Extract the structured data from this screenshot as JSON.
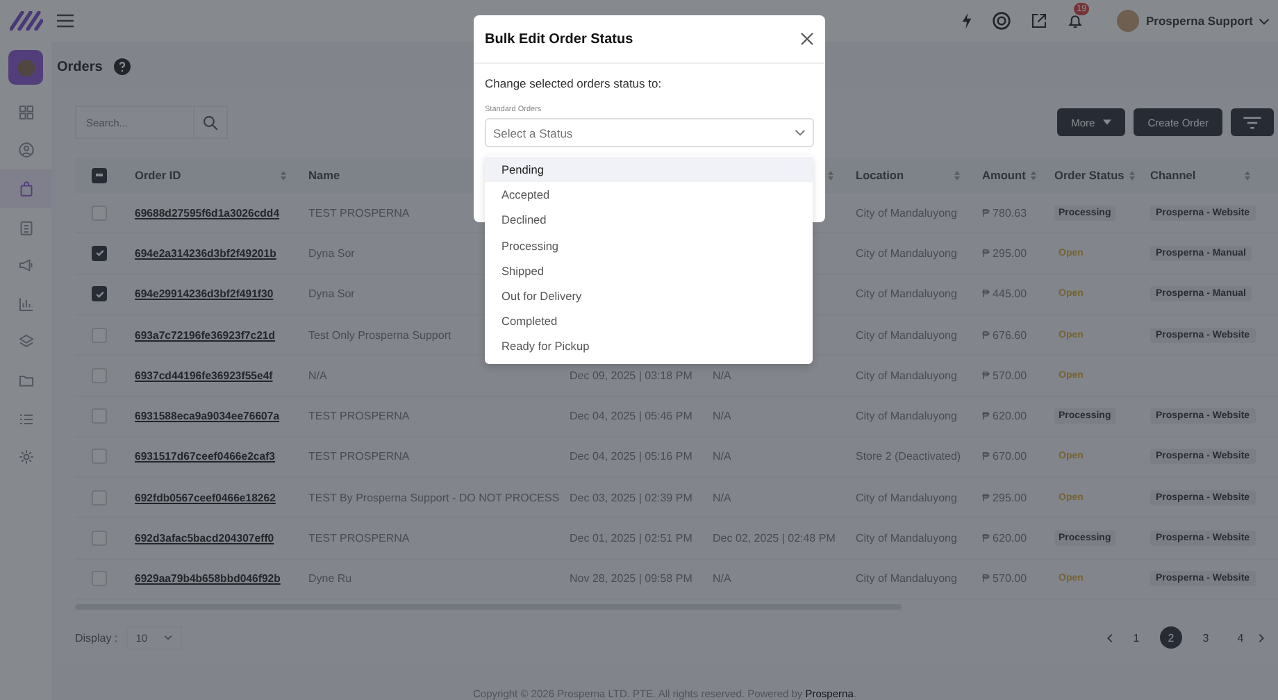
{
  "topbar": {
    "notifications": "19",
    "user": "Prosperna Support"
  },
  "sidebar": {
    "items": [
      {
        "kind": "dashboard",
        "selected": false
      },
      {
        "kind": "user",
        "selected": false
      },
      {
        "kind": "bag",
        "selected": true
      },
      {
        "kind": "clipboard",
        "selected": false
      },
      {
        "kind": "megaphone",
        "selected": false
      },
      {
        "kind": "chart",
        "selected": false
      },
      {
        "kind": "layers",
        "selected": false
      },
      {
        "kind": "folder",
        "selected": false
      },
      {
        "kind": "list",
        "selected": false
      },
      {
        "kind": "gear",
        "selected": false
      }
    ]
  },
  "page": {
    "title": "Orders"
  },
  "search": {
    "placeholder": "Search..."
  },
  "buttons": [
    {
      "kind": "menu",
      "label": "More"
    },
    {
      "kind": "plain",
      "label": "Create Order"
    },
    {
      "kind": "filter"
    }
  ],
  "table": {
    "header_checkbox": {
      "indeterminate": true
    },
    "columns": [
      {
        "label": "Order ID",
        "sortable": true
      },
      {
        "label": "Name",
        "sortable": false
      },
      {},
      {
        "sortable": true
      },
      {
        "label": "Location",
        "sortable": true
      },
      {
        "label": "Amount",
        "sortable": true
      },
      {
        "label": "Order Status",
        "sortable": true
      },
      {
        "label": "Channel",
        "sortable": true
      }
    ],
    "rows": [
      {
        "checked": false,
        "order_id": "69688d27595f6d1a3026cdd4",
        "name": "TEST PROSPERNA",
        "location": "City of Mandaluyong",
        "amount": "₱ 780.63",
        "status": "Processing",
        "status_badge": true,
        "channel": "Prosperna - Website"
      },
      {
        "checked": true,
        "order_id": "694e2a314236d3bf2f49201b",
        "name": "Dyna Sor",
        "location": "City of Mandaluyong",
        "amount": "₱ 295.00",
        "status": "Open",
        "status_badge": false,
        "channel": "Prosperna - Manual"
      },
      {
        "checked": true,
        "order_id": "694e29914236d3bf2f491f30",
        "name": "Dyna Sor",
        "location": "City of Mandaluyong",
        "amount": "₱ 445.00",
        "status": "Open",
        "status_badge": false,
        "channel": "Prosperna - Manual"
      },
      {
        "checked": false,
        "order_id": "693a7c72196fe36923f7c21d",
        "name": "Test Only Prosperna Support",
        "location": "City of Mandaluyong",
        "amount": "₱ 676.60",
        "status": "Open",
        "status_badge": false,
        "channel": "Prosperna - Website"
      },
      {
        "checked": false,
        "order_id": "6937cd44196fe36923f55e4f",
        "name": "N/A",
        "column_3": "Dec 09, 2025 | 03:18 PM",
        "column_4": "N/A",
        "location": "City of Mandaluyong",
        "amount": "₱ 570.00",
        "status": "Open",
        "status_badge": false
      },
      {
        "checked": false,
        "order_id": "6931588eca9a9034ee76607a",
        "name": "TEST PROSPERNA",
        "column_3": "Dec 04, 2025 | 05:46 PM",
        "column_4": "N/A",
        "location": "City of Mandaluyong",
        "amount": "₱ 620.00",
        "status": "Processing",
        "status_badge": true,
        "channel": "Prosperna - Website"
      },
      {
        "checked": false,
        "order_id": "6931517d67ceef0466e2caf3",
        "name": "TEST PROSPERNA",
        "column_3": "Dec 04, 2025 | 05:16 PM",
        "column_4": "N/A",
        "location": "Store 2 (Deactivated)",
        "amount": "₱ 670.00",
        "status": "Open",
        "status_badge": false,
        "channel": "Prosperna - Website"
      },
      {
        "checked": false,
        "order_id": "692fdb0567ceef0466e18262",
        "name": "TEST By Prosperna Support - DO NOT PROCESS",
        "column_3": "Dec 03, 2025 | 02:39 PM",
        "column_4": "N/A",
        "location": "City of Mandaluyong",
        "amount": "₱ 295.00",
        "status": "Open",
        "status_badge": false,
        "channel": "Prosperna - Website"
      },
      {
        "checked": false,
        "order_id": "692d3afac5bacd204307eff0",
        "name": "TEST PROSPERNA",
        "column_3": "Dec 01, 2025 | 02:51 PM",
        "column_4": "Dec 02, 2025 | 02:48 PM",
        "location": "City of Mandaluyong",
        "amount": "₱ 620.00",
        "status": "Processing",
        "status_badge": true,
        "channel": "Prosperna - Website"
      },
      {
        "checked": false,
        "order_id": "6929aa79b4b658bbd046f92b",
        "name": "Dyne Ru",
        "column_3": "Nov 28, 2025 | 09:58 PM",
        "column_4": "N/A",
        "location": "City of Mandaluyong",
        "amount": "₱ 570.00",
        "status": "Open",
        "status_badge": false,
        "channel": "Prosperna - Website"
      }
    ]
  },
  "display": {
    "label": "Display :",
    "value": "10"
  },
  "pagination": {
    "pages": [
      {
        "label": "1",
        "selected": false
      },
      {
        "label": "2",
        "selected": true
      },
      {
        "label": "3",
        "selected": false
      },
      {
        "label": "4",
        "selected": false
      }
    ]
  },
  "footer": "Copyright © 2026 Prosperna LTD. PTE. All rights reserved. Powered by **Prosperna**.",
  "modal": {
    "title": "Bulk Edit Order Status",
    "prompt": "Change selected orders status to:",
    "field_label": "Standard Orders",
    "placeholder": "Select a Status",
    "options": [
      {
        "label": "Pending",
        "selected": true
      },
      {
        "label": "Accepted",
        "selected": false
      },
      {
        "label": "Declined",
        "selected": false
      },
      {
        "label": "Processing",
        "selected": false
      },
      {
        "label": "Shipped",
        "selected": false
      },
      {
        "label": "Out for Delivery",
        "selected": false
      },
      {
        "label": "Completed",
        "selected": false
      },
      {
        "label": "Ready for Pickup",
        "selected": false
      }
    ]
  }
}
